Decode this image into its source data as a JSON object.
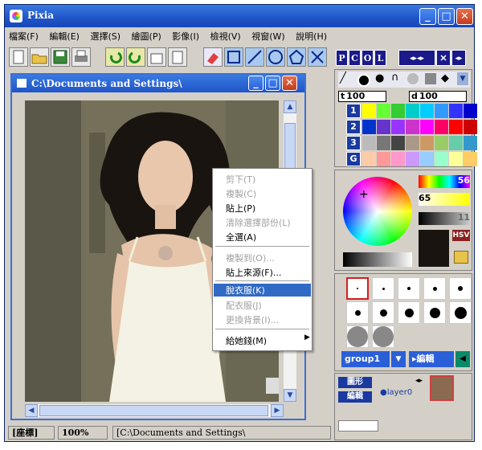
{
  "window": {
    "title": "Pixia"
  },
  "menu": [
    "檔案(F)",
    "編輯(E)",
    "選擇(S)",
    "繪圖(P)",
    "影像(I)",
    "檢視(V)",
    "視窗(W)",
    "說明(H)"
  ],
  "toolbar_right": {
    "letters": [
      "P",
      "C",
      "O",
      "L"
    ]
  },
  "document": {
    "title": "C:\\Documents and Settings\\"
  },
  "context_menu": {
    "items": [
      {
        "label": "剪下(T)",
        "enabled": false
      },
      {
        "label": "複製(C)",
        "enabled": false
      },
      {
        "label": "貼上(P)",
        "enabled": true
      },
      {
        "label": "清除選擇部份(L)",
        "enabled": false
      },
      {
        "label": "全選(A)",
        "enabled": true
      },
      {
        "label": "複製到(O)...",
        "enabled": false
      },
      {
        "label": "貼上來源(F)...",
        "enabled": true
      },
      {
        "label": "脫衣服(K)",
        "enabled": true,
        "selected": true
      },
      {
        "label": "配衣服(J)",
        "enabled": false
      },
      {
        "label": "更換背景(I)...",
        "enabled": false
      },
      {
        "label": "給她錢(M)",
        "enabled": true
      }
    ]
  },
  "palette": {
    "t_value": "100",
    "d_value": "100",
    "row_numbers": [
      "1",
      "2",
      "3",
      "G"
    ]
  },
  "color": {
    "value_56": "56",
    "value_65": "65",
    "value_11": "11",
    "hsv_label": "HSV"
  },
  "layers": {
    "group_label": "group1",
    "edit_label": "編輯",
    "shape_label": "圖形",
    "edit2_label": "編輯",
    "layer_name": "layer0"
  },
  "status": {
    "coords_label": "[座標]",
    "zoom": "100%",
    "path": "[C:\\Documents and Settings\\"
  },
  "colors": {
    "title_blue": "#1f54c8",
    "menu_highlight": "#316ac5",
    "panel": "#d4d0c8"
  }
}
